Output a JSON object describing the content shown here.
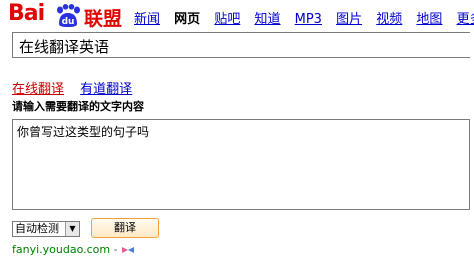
{
  "header": {
    "logo_text_left": "Bai",
    "logo_text_right": "联盟",
    "logo_paw_text": "du",
    "nav_current": "网页",
    "nav_items": [
      "新闻",
      "贴吧",
      "知道",
      "MP3",
      "图片",
      "视频",
      "地图"
    ],
    "nav_more": "更多",
    "brand_color": "#e10602"
  },
  "search": {
    "value": "在线翻译英语"
  },
  "translator": {
    "tab_active": "在线翻译",
    "tab_other": "有道翻译",
    "instruction": "请输入需要翻译的文字内容",
    "input_value": "你曾写过这类型的句子吗",
    "language_select": "自动检测",
    "translate_button": "翻译"
  },
  "footer": {
    "url": "fanyi.youdao.com",
    "separator": "-"
  }
}
